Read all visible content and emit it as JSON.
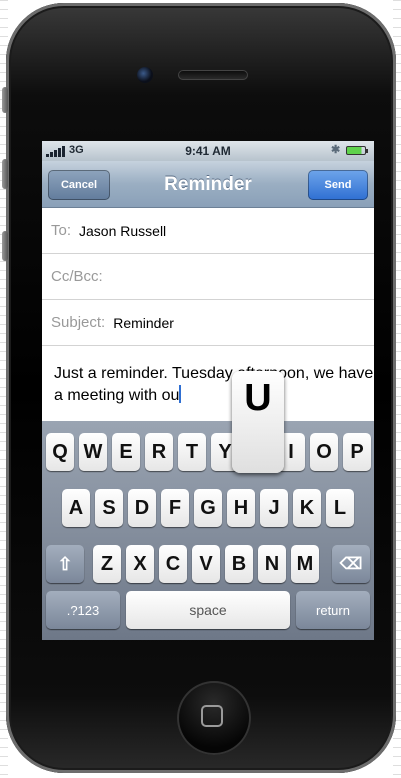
{
  "status_bar": {
    "network": "3G",
    "time": "9:41 AM"
  },
  "nav": {
    "cancel": "Cancel",
    "title": "Reminder",
    "send": "Send"
  },
  "fields": {
    "to": {
      "label": "To:",
      "value": "Jason Russell"
    },
    "cc": {
      "label": "Cc/Bcc:"
    },
    "subject": {
      "label": "Subject:",
      "value": "Reminder"
    }
  },
  "body": {
    "text": "Just a reminder. Tuesday afternoon, we have a meeting with ou"
  },
  "keyboard": {
    "row1": [
      "Q",
      "W",
      "E",
      "R",
      "T",
      "Y",
      "U",
      "I",
      "O",
      "P"
    ],
    "row2": [
      "A",
      "S",
      "D",
      "F",
      "G",
      "H",
      "J",
      "K",
      "L"
    ],
    "row3": [
      "Z",
      "X",
      "C",
      "V",
      "B",
      "N",
      "M"
    ],
    "numbers": ".?123",
    "space": "space",
    "return": "return",
    "popup_key": "U"
  },
  "icons": [
    "signal-bars-icon",
    "bluetooth-icon",
    "battery-icon",
    "shift-icon",
    "delete-icon",
    "camera-icon",
    "home-button-icon"
  ]
}
